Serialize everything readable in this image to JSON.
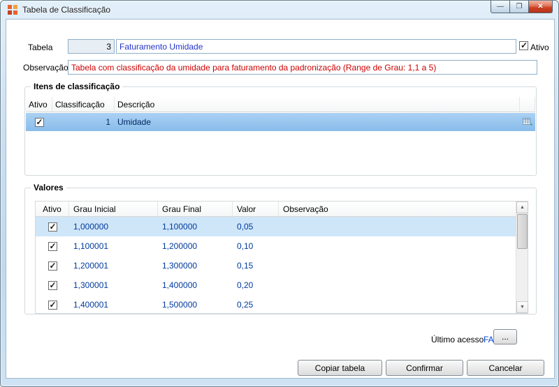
{
  "window": {
    "title": "Tabela de Classificação",
    "controls": {
      "minimize": "—",
      "maximize": "❐",
      "close": "✕"
    }
  },
  "form": {
    "tabela": {
      "label": "Tabela",
      "id_value": "3",
      "name_value": "Faturamento Umidade"
    },
    "ativo": {
      "label": "Ativo",
      "checked": true
    },
    "observacao": {
      "label": "Observação",
      "value": "Tabela com classificação da umidade para faturamento da padronização (Range de Grau: 1,1 a 5)"
    }
  },
  "itens": {
    "title": "Itens de classificação",
    "columns": [
      "Ativo",
      "Classificação",
      "Descrição",
      ""
    ],
    "rows": [
      {
        "ativo": true,
        "classificacao": "1",
        "descricao": "Umidade",
        "selected": true
      }
    ]
  },
  "valores": {
    "title": "Valores",
    "columns": [
      "Ativo",
      "Grau Inicial",
      "Grau Final",
      "Valor",
      "Observação"
    ],
    "rows": [
      {
        "ativo": true,
        "grau_inicial": "1,000000",
        "grau_final": "1,100000",
        "valor": "0,05",
        "observacao": "",
        "selected": true
      },
      {
        "ativo": true,
        "grau_inicial": "1,100001",
        "grau_final": "1,200000",
        "valor": "0,10",
        "observacao": "",
        "selected": false
      },
      {
        "ativo": true,
        "grau_inicial": "1,200001",
        "grau_final": "1,300000",
        "valor": "0,15",
        "observacao": "",
        "selected": false
      },
      {
        "ativo": true,
        "grau_inicial": "1,300001",
        "grau_final": "1,400000",
        "valor": "0,20",
        "observacao": "",
        "selected": false
      },
      {
        "ativo": true,
        "grau_inicial": "1,400001",
        "grau_final": "1,500000",
        "valor": "0,25",
        "observacao": "",
        "selected": false
      }
    ]
  },
  "footer": {
    "ultimo_acesso_label": "Último acesso",
    "ultimo_acesso_value": "FAC",
    "more_button": "...",
    "buttons": {
      "copiar": "Copiar tabela",
      "confirmar": "Confirmar",
      "cancelar": "Cancelar"
    }
  },
  "colors": {
    "table_text": "#003a9e",
    "observacao_text": "#cc0000",
    "name_text": "#2233cc",
    "selection_itens": "#88bceb",
    "selection_valores": "#cfe6f8",
    "link": "#0046d5",
    "close_button": "#cf3f22"
  }
}
